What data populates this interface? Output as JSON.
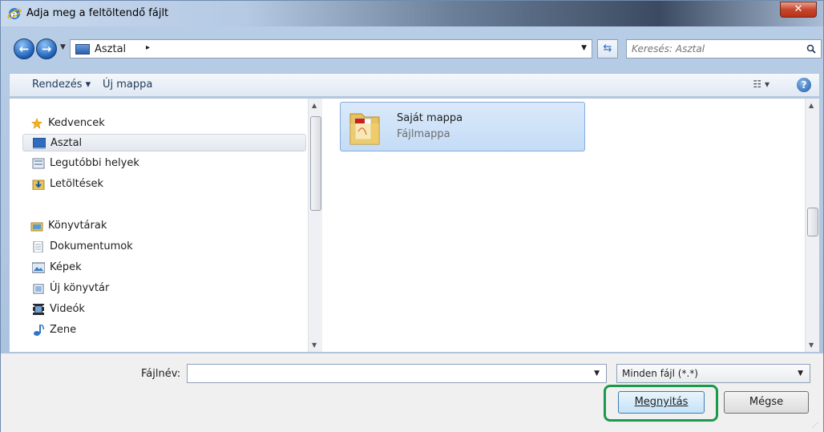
{
  "window": {
    "title": "Adja meg a feltöltendő fájlt",
    "close_label": "✕"
  },
  "nav": {
    "back_icon": "back-arrow-icon",
    "forward_icon": "forward-arrow-icon",
    "address": "Asztal",
    "address_arrow": "▸",
    "search_placeholder": "Keresés: Asztal"
  },
  "toolbar": {
    "organize": "Rendezés ▾",
    "new_folder": "Új mappa",
    "help": "?"
  },
  "sidebar": {
    "items": [
      {
        "label": "Kedvencek",
        "icon": "star-icon",
        "group": true,
        "selected": false
      },
      {
        "label": "Asztal",
        "icon": "desktop-icon",
        "group": false,
        "selected": true
      },
      {
        "label": "Legutóbbi helyek",
        "icon": "recent-places-icon",
        "group": false,
        "selected": false
      },
      {
        "label": "Letöltések",
        "icon": "downloads-icon",
        "group": false,
        "selected": false
      },
      {
        "label": "Könyvtárak",
        "icon": "libraries-icon",
        "group": true,
        "selected": false
      },
      {
        "label": "Dokumentumok",
        "icon": "documents-icon",
        "group": false,
        "selected": false
      },
      {
        "label": "Képek",
        "icon": "pictures-icon",
        "group": false,
        "selected": false
      },
      {
        "label": "Új könyvtár",
        "icon": "new-library-icon",
        "group": false,
        "selected": false
      },
      {
        "label": "Videók",
        "icon": "videos-icon",
        "group": false,
        "selected": false
      },
      {
        "label": "Zene",
        "icon": "music-icon",
        "group": false,
        "selected": false
      }
    ]
  },
  "files": [
    {
      "name": "Saját mappa",
      "type": "Fájlmappa",
      "icon": "pdf-folder-icon",
      "selected": true
    }
  ],
  "footer": {
    "filename_label": "Fájlnév:",
    "filename_value": "",
    "filter": "Minden fájl (*.*)",
    "open_label": "Megnyitás",
    "cancel_label": "Mégse"
  },
  "colors": {
    "highlight": "#1a9a4a",
    "selection": "#c4dcf6",
    "accent": "#1d5aa8"
  }
}
